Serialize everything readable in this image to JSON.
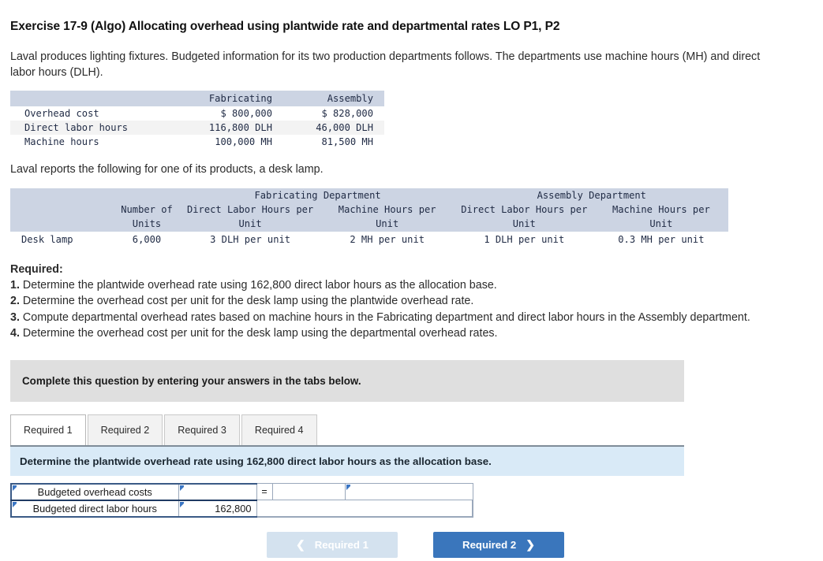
{
  "exercise": {
    "title": "Exercise 17-9 (Algo) Allocating overhead using plantwide rate and departmental rates LO P1, P2",
    "intro": "Laval produces lighting fixtures. Budgeted information for its two production departments follows. The departments use machine hours (MH) and direct labor hours (DLH).",
    "second_intro": "Laval reports the following for one of its products, a desk lamp."
  },
  "overhead_table": {
    "columns": [
      "",
      "Fabricating",
      "Assembly"
    ],
    "rows": [
      {
        "label": "Overhead cost",
        "fabricating": "$ 800,000",
        "assembly": "$ 828,000"
      },
      {
        "label": "Direct labor hours",
        "fabricating": "116,800 DLH",
        "assembly": "46,000 DLH"
      },
      {
        "label": "Machine hours",
        "fabricating": "100,000 MH",
        "assembly": "81,500 MH"
      }
    ]
  },
  "product_table": {
    "group_headers": [
      "",
      "",
      "Fabricating Department",
      "Assembly Department"
    ],
    "sub_headers": [
      "",
      "Number of Units",
      "Direct Labor Hours per Unit",
      "Machine Hours per Unit",
      "Direct Labor Hours per Unit",
      "Machine Hours per Unit"
    ],
    "sub_headers_line1": [
      "",
      "Number of",
      "Direct Labor Hours per",
      "Machine Hours per",
      "Direct Labor Hours per",
      "Machine Hours per"
    ],
    "sub_headers_line2": [
      "",
      "Units",
      "Unit",
      "Unit",
      "Unit",
      "Unit"
    ],
    "rows": [
      {
        "label": "Desk lamp",
        "units": "6,000",
        "fab_dlh": "3 DLH per unit",
        "fab_mh": "2 MH per unit",
        "asm_dlh": "1 DLH per unit",
        "asm_mh": "0.3 MH per unit"
      }
    ]
  },
  "required": {
    "heading": "Required:",
    "items": [
      {
        "num": "1.",
        "text": "Determine the plantwide overhead rate using 162,800 direct labor hours as the allocation base."
      },
      {
        "num": "2.",
        "text": "Determine the overhead cost per unit for the desk lamp using the plantwide overhead rate."
      },
      {
        "num": "3.",
        "text": "Compute departmental overhead rates based on machine hours in the Fabricating department and direct labor hours in the Assembly department."
      },
      {
        "num": "4.",
        "text": "Determine the overhead cost per unit for the desk lamp using the departmental overhead rates."
      }
    ]
  },
  "instruction_banner": {
    "text": "Complete this question by entering your answers in the tabs below."
  },
  "tabs": [
    {
      "label": "Required 1",
      "active": true
    },
    {
      "label": "Required 2",
      "active": false
    },
    {
      "label": "Required 3",
      "active": false
    },
    {
      "label": "Required 4",
      "active": false
    }
  ],
  "question_bar": {
    "text": "Determine the plantwide overhead rate using 162,800 direct labor hours as the allocation base."
  },
  "answer_grid": {
    "rows": [
      {
        "label": "Budgeted overhead costs",
        "value": "",
        "operator": "=",
        "result1": "",
        "result2": ""
      },
      {
        "label": "Budgeted direct labor hours",
        "value": "162,800",
        "operator": "",
        "result1": "",
        "result2": ""
      }
    ]
  },
  "navigation": {
    "prev_label": "Required 1",
    "prev_icon": "chevron-left-icon",
    "next_label": "Required 2",
    "next_icon": "chevron-right-icon"
  },
  "colors": {
    "table_header_bg": "#ccd4e3",
    "banner_bg": "#dfdfdf",
    "question_bar_bg": "#d9eaf7",
    "input_highlight": "#fcfcaa",
    "primary_button": "#3a76bc",
    "disabled_button": "#d4e2ef",
    "cell_border": "#9aa8bb"
  }
}
